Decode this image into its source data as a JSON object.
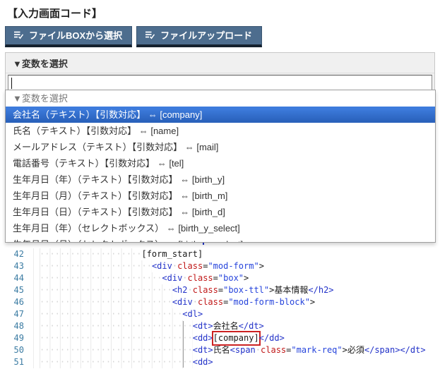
{
  "page": {
    "title": "【入力画面コード】"
  },
  "toolbar": {
    "buttons": [
      {
        "label": "ファイルBOXから選択",
        "icon": "list-check-icon"
      },
      {
        "label": "ファイルアップロード",
        "icon": "list-check-icon"
      }
    ]
  },
  "variable_panel": {
    "header": "▼変数を選択",
    "search_value": "",
    "options": [
      {
        "label": "▼変数を選択",
        "type": "placeholder"
      },
      {
        "label": "会社名（テキスト）【引数対応】  ⇔  [company]",
        "type": "selected"
      },
      {
        "label": "氏名（テキスト）【引数対応】  ⇔  [name]",
        "type": "normal"
      },
      {
        "label": "メールアドレス（テキスト）【引数対応】  ⇔  [mail]",
        "type": "normal"
      },
      {
        "label": "電話番号（テキスト）【引数対応】  ⇔  [tel]",
        "type": "normal"
      },
      {
        "label": "生年月日（年）（テキスト）【引数対応】  ⇔  [birth_y]",
        "type": "normal"
      },
      {
        "label": "生年月日（月）（テキスト）【引数対応】  ⇔  [birth_m]",
        "type": "normal"
      },
      {
        "label": "生年月日（日）（テキスト）【引数対応】  ⇔  [birth_d]",
        "type": "normal"
      },
      {
        "label": "生年月日（年）（セレクトボックス）  ⇔  [birth_y_select]",
        "type": "normal"
      },
      {
        "label": "生年月日（月）（セレクトボックス）  ⇔  [birth_m_select]",
        "type": "normal"
      }
    ]
  },
  "editor": {
    "lines": [
      {
        "num": 42,
        "indent": 20,
        "tokens": [
          {
            "c": "plain",
            "t": "[form_start]"
          }
        ]
      },
      {
        "num": 43,
        "indent": 22,
        "tokens": [
          {
            "c": "tag",
            "t": "<div"
          },
          {
            "c": "ws",
            "t": "·"
          },
          {
            "c": "attr",
            "t": "class"
          },
          {
            "c": "plain",
            "t": "="
          },
          {
            "c": "str",
            "t": "\"mod-form\""
          },
          {
            "c": "plain",
            "t": ">"
          }
        ]
      },
      {
        "num": 44,
        "indent": 24,
        "tokens": [
          {
            "c": "tag",
            "t": "<div"
          },
          {
            "c": "ws",
            "t": "·"
          },
          {
            "c": "attr",
            "t": "class"
          },
          {
            "c": "plain",
            "t": "="
          },
          {
            "c": "str",
            "t": "\"box\""
          },
          {
            "c": "plain",
            "t": ">"
          }
        ]
      },
      {
        "num": 45,
        "indent": 26,
        "tokens": [
          {
            "c": "tag",
            "t": "<h2"
          },
          {
            "c": "ws",
            "t": "·"
          },
          {
            "c": "attr",
            "t": "class"
          },
          {
            "c": "plain",
            "t": "="
          },
          {
            "c": "str",
            "t": "\"box-ttl\""
          },
          {
            "c": "plain",
            "t": ">"
          },
          {
            "c": "plain",
            "t": "基本情報"
          },
          {
            "c": "tag",
            "t": "</h2>"
          }
        ]
      },
      {
        "num": 46,
        "indent": 26,
        "tokens": [
          {
            "c": "tag",
            "t": "<div"
          },
          {
            "c": "ws",
            "t": "·"
          },
          {
            "c": "attr",
            "t": "class"
          },
          {
            "c": "plain",
            "t": "="
          },
          {
            "c": "str",
            "t": "\"mod-form-block\""
          },
          {
            "c": "plain",
            "t": ">"
          }
        ]
      },
      {
        "num": 47,
        "indent": 28,
        "tokens": [
          {
            "c": "tag",
            "t": "<dl>"
          }
        ]
      },
      {
        "num": 48,
        "indent": 30,
        "tokens": [
          {
            "c": "tag",
            "t": "<dt>"
          },
          {
            "c": "plain",
            "t": "会社名"
          },
          {
            "c": "tag",
            "t": "</dt>"
          }
        ]
      },
      {
        "num": 49,
        "indent": 30,
        "tokens": [
          {
            "c": "tag",
            "t": "<dd>"
          },
          {
            "c": "boxed",
            "t": "[company]"
          },
          {
            "c": "tag",
            "t": "</dd>"
          }
        ]
      },
      {
        "num": 50,
        "indent": 30,
        "tokens": [
          {
            "c": "tag",
            "t": "<dt>"
          },
          {
            "c": "plain",
            "t": "氏名"
          },
          {
            "c": "tag",
            "t": "<span"
          },
          {
            "c": "ws",
            "t": "·"
          },
          {
            "c": "attr",
            "t": "class"
          },
          {
            "c": "plain",
            "t": "="
          },
          {
            "c": "str",
            "t": "\"mark-req\""
          },
          {
            "c": "plain",
            "t": ">"
          },
          {
            "c": "plain",
            "t": "必須"
          },
          {
            "c": "tag",
            "t": "</span>"
          },
          {
            "c": "tag",
            "t": "</dt>"
          }
        ]
      },
      {
        "num": 51,
        "indent": 30,
        "tokens": [
          {
            "c": "tag",
            "t": "<dd>"
          }
        ]
      }
    ]
  },
  "colors": {
    "accent_top": "#3d7bdc",
    "accent_bottom": "#2a62bc",
    "button_bg": "#4d6d8e",
    "button_bottom": "#15212e",
    "line_number": "#3c7ca3",
    "syntax_tag": "#2131c8",
    "syntax_attr": "#c01818",
    "syntax_string": "#2644dc",
    "syntax_plain": "#1a1a1a",
    "highlight_box": "#cc2222"
  }
}
